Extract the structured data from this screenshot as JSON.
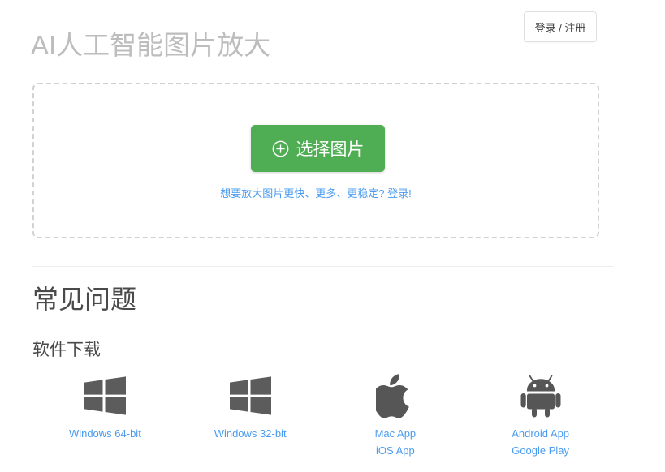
{
  "header": {
    "title": "AI人工智能图片放大",
    "login_label": "登录 / 注册"
  },
  "upload": {
    "select_button_label": "选择图片",
    "select_button_icon": "plus-circle-icon",
    "select_button_color": "#4fad53",
    "upsell_text": "想要放大图片更快、更多、更稳定? 登录!",
    "link_color": "#4a9bf0"
  },
  "faq": {
    "heading": "常见问题",
    "downloads_heading": "软件下载"
  },
  "downloads": [
    {
      "icon": "windows-logo-icon",
      "links": [
        "Windows 64-bit"
      ]
    },
    {
      "icon": "windows-logo-icon",
      "links": [
        "Windows 32-bit"
      ]
    },
    {
      "icon": "apple-logo-icon",
      "links": [
        "Mac App",
        "iOS App"
      ]
    },
    {
      "icon": "android-logo-icon",
      "links": [
        "Android App",
        "Google Play"
      ]
    }
  ]
}
